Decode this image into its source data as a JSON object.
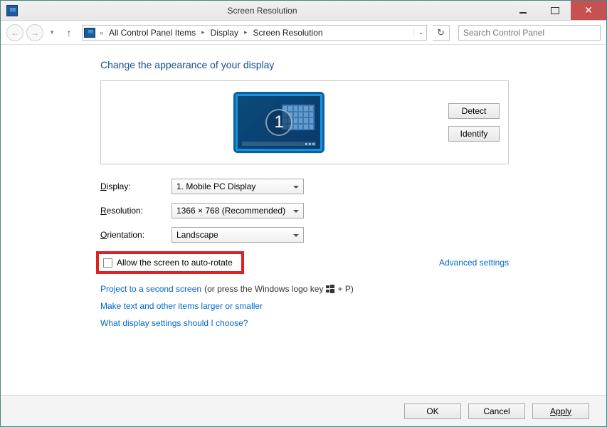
{
  "window": {
    "title": "Screen Resolution"
  },
  "nav": {
    "breadcrumb": [
      "All Control Panel Items",
      "Display",
      "Screen Resolution"
    ],
    "search_placeholder": "Search Control Panel"
  },
  "main": {
    "heading": "Change the appearance of your display",
    "monitor_number": "1",
    "detect_label": "Detect",
    "identify_label": "Identify",
    "rows": {
      "display": {
        "label_pre": "D",
        "label_post": "isplay:",
        "value": "1. Mobile PC Display"
      },
      "resolution": {
        "label_pre": "R",
        "label_post": "esolution:",
        "value": "1366 × 768 (Recommended)"
      },
      "orientation": {
        "label_pre": "O",
        "label_post": "rientation:",
        "value": "Landscape"
      }
    },
    "auto_rotate_label": "Allow the screen to auto-rotate",
    "advanced_link": "Advanced settings",
    "project_link": "Project to a second screen",
    "project_suffix": " (or press the Windows logo key ",
    "project_suffix2": " + P)",
    "textsize_link": "Make text and other items larger or smaller",
    "help_link": "What display settings should I choose?"
  },
  "footer": {
    "ok": "OK",
    "cancel": "Cancel",
    "apply": "Apply"
  }
}
